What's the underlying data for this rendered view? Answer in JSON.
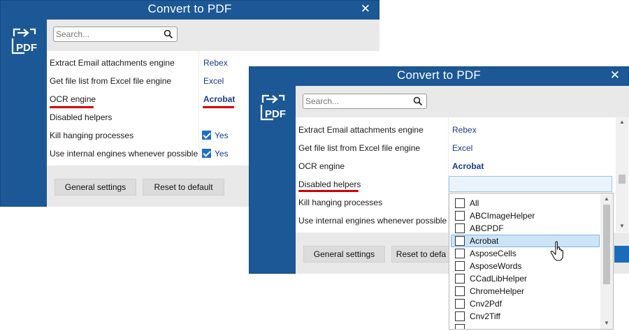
{
  "window1": {
    "title": "Convert to PDF",
    "close": "✕",
    "search_placeholder": "Search...",
    "rows": [
      {
        "label": "Extract Email attachments engine",
        "value": "Rebex"
      },
      {
        "label": "Get file list from Excel file engine",
        "value": "Excel"
      },
      {
        "label": "OCR engine",
        "value": "Acrobat"
      },
      {
        "label": "Disabled helpers",
        "value": ""
      },
      {
        "label": "Kill hanging processes",
        "value": "Yes",
        "checked": true
      },
      {
        "label": "Use internal engines whenever possible",
        "value": "Yes",
        "checked": true
      }
    ],
    "buttons": {
      "general": "General settings",
      "reset": "Reset to default"
    }
  },
  "window2": {
    "title": "Convert to PDF",
    "close": "✕",
    "search_placeholder": "Search...",
    "rows": [
      {
        "label": "Extract Email attachments engine",
        "value": "Rebex"
      },
      {
        "label": "Get file list from Excel file engine",
        "value": "Excel"
      },
      {
        "label": "OCR engine",
        "value": "Acrobat"
      },
      {
        "label": "Disabled helpers",
        "value": ""
      },
      {
        "label": "Kill hanging processes",
        "value": ""
      },
      {
        "label": "Use internal engines whenever possible",
        "value": ""
      }
    ],
    "buttons": {
      "general": "General settings",
      "reset": "Reset to defa"
    }
  },
  "dropdown": {
    "options": [
      "All",
      "ABCImageHelper",
      "ABCPDF",
      "Acrobat",
      "AsposeCells",
      "AsposeWords",
      "CCadLibHelper",
      "ChromeHelper",
      "Cnv2Pdf",
      "Cnv2Tiff"
    ],
    "highlighted": "Acrobat"
  },
  "colors": {
    "brand_blue": "#1c5895",
    "value_text": "#1a3a8a",
    "highlight_underline": "#d40000",
    "checkbox_checked": "#1f6fc4",
    "dropdown_highlight": "#cce4f7"
  },
  "icons": [
    "convert-to-pdf-logo-icon",
    "search-icon",
    "close-icon",
    "checkbox-icon",
    "mouse-cursor-icon"
  ]
}
